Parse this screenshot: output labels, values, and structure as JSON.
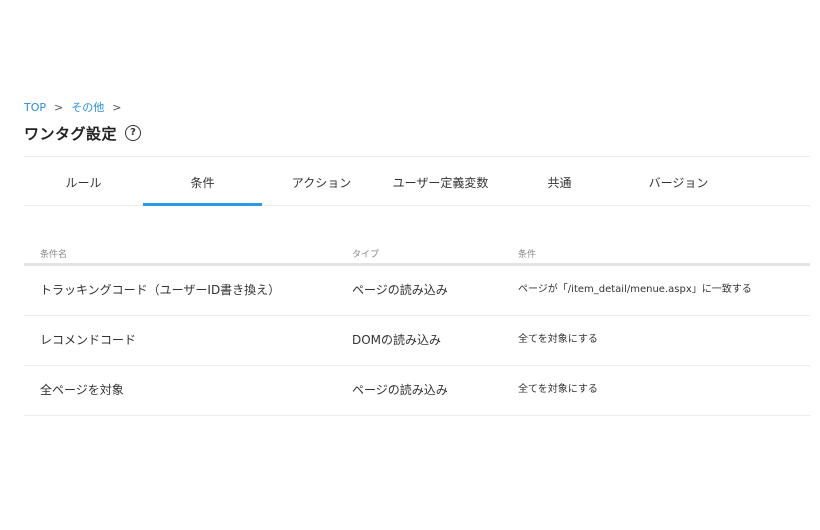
{
  "breadcrumb": {
    "top": "TOP",
    "sep1": ">",
    "other": "その他",
    "sep2": ">"
  },
  "title": "ワンタグ設定",
  "help_icon": "?",
  "tabs": [
    {
      "label": "ルール"
    },
    {
      "label": "条件",
      "active": true
    },
    {
      "label": "アクション"
    },
    {
      "label": "ユーザー定義変数"
    },
    {
      "label": "共通"
    },
    {
      "label": "バージョン"
    }
  ],
  "table": {
    "headers": {
      "name": "条件名",
      "type": "タイプ",
      "condition": "条件"
    },
    "rows": [
      {
        "name": "トラッキングコード（ユーザーID書き換え）",
        "type": "ページの読み込み",
        "condition": "ページが「/item_detail/menue.aspx」に一致する"
      },
      {
        "name": "レコメンドコード",
        "type": "DOMの読み込み",
        "condition": "全てを対象にする"
      },
      {
        "name": "全ページを対象",
        "type": "ページの読み込み",
        "condition": "全てを対象にする"
      }
    ]
  },
  "colors": {
    "accent": "#2b9be6",
    "link": "#2a8fd8"
  }
}
